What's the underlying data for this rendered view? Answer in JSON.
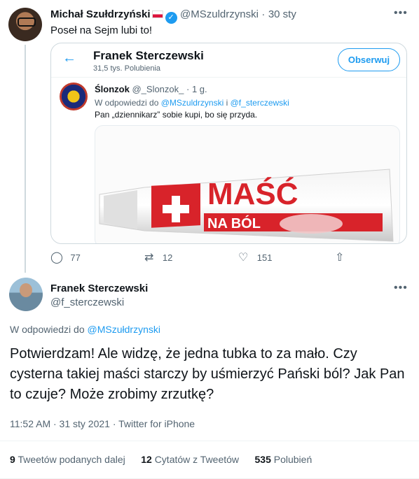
{
  "tweet1": {
    "author_name": "Michał Szułdrzyński",
    "handle": "@MSzuldrzynski",
    "separator": "·",
    "time": "30 sty",
    "text": "Poseł na Sejm lubi to!",
    "more_icon": "more-icon",
    "card": {
      "back_icon": "arrow-left-icon",
      "profile_name": "Franek Sterczewski",
      "profile_likes": "31,5 tys. Polubienia",
      "follow_label": "Obserwuj",
      "inner_tweet": {
        "author_name": "Ślonzok",
        "handle": "@_Slonzok_",
        "time": "· 1 g.",
        "reply_prefix": "W odpowiedzi do",
        "reply_to_1": "@MSzuldrzynski",
        "reply_and": "i",
        "reply_to_2": "@f_sterczewski",
        "text": "Pan „dziennikarz” sobie kupi, bo się przyda.",
        "media": {
          "line1": "MAŚĆ",
          "line2": "NA BÓL"
        }
      }
    },
    "actions": {
      "reply_count": "77",
      "retweet_count": "12",
      "like_count": "151"
    }
  },
  "tweet2": {
    "author_name": "Franek Sterczewski",
    "handle": "@f_sterczewski",
    "reply_prefix": "W odpowiedzi do",
    "reply_to": "@MSzułdrzynski",
    "text": "Potwierdzam! Ale widzę, że jedna tubka to za mało. Czy cysterna takiej maści starczy by uśmierzyć Pański ból? Jak Pan to czuje? Może zrobimy zrzutkę?",
    "timestamp": "11:52 AM · 31 sty 2021",
    "separator": "·",
    "source": "Twitter for iPhone",
    "stats": {
      "retweets_count": "9",
      "retweets_label": "Tweetów podanych dalej",
      "quotes_count": "12",
      "quotes_label": "Cytatów z Tweetów",
      "likes_count": "535",
      "likes_label": "Polubień"
    }
  },
  "colors": {
    "accent": "#1d9bf0",
    "muted": "#536471",
    "border": "#cfd9de",
    "tube_red": "#d8232a"
  }
}
